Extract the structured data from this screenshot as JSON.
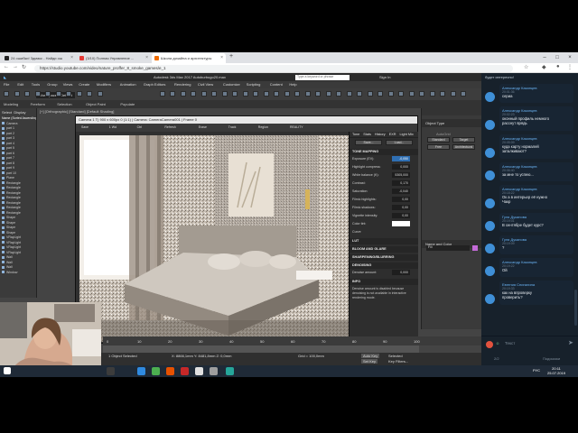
{
  "browser": {
    "tabs": [
      {
        "label": "24 ошибки! 3дмакс - Найди ош"
      },
      {
        "label": "(3/10) Полная Управление ..."
      },
      {
        "label": "Школа дизайна и архитектуры"
      }
    ],
    "url": "https://studio.youtube.com/video/nature_proffer_8_smoke_games/e_1"
  },
  "max": {
    "title": "Autodesk 3ds Max 2017   Autoburbugo20.max",
    "search_placeholder": "Type a keyword or phrase",
    "sign_in": "Sign In",
    "menus": [
      "File",
      "Edit",
      "Tools",
      "Group",
      "Views",
      "Create",
      "Modifiers",
      "Animation",
      "Graph Editors",
      "Rendering",
      "Civil View",
      "Customize",
      "Scripting",
      "Content",
      "Help"
    ],
    "workspace": "Workspaces: Default",
    "ribbon_tabs": [
      "Modeling",
      "Freeform",
      "Selection",
      "Object Paint",
      "Populate"
    ],
    "scene_header": [
      "Select",
      "Display"
    ],
    "scene_col": "Name (Sorted Ascending)",
    "scene_rows": [
      "Camera",
      "part 1",
      "part 2",
      "part 3",
      "part 4",
      "part 5",
      "part 6",
      "part 7",
      "part 8",
      "part 9",
      "part 10",
      "Plane",
      "Rectangle",
      "Rectangle",
      "Rectangle",
      "Rectangle",
      "Rectangle",
      "Rectangle",
      "Rectangle",
      "Shape",
      "Shape",
      "Shape",
      "Shape",
      "VRayLight",
      "VRayLight",
      "VRayLight",
      "VRayLight",
      "Wall",
      "Wall",
      "Wall",
      "Window"
    ],
    "viewport_label": "[+] [Orthographic] [Standard] [Default Shading]",
    "render_window": {
      "title": "Camera 1 T) 900 x 600px 0 (1:1) | Camera: CameraCamera001 | Frame 0",
      "toolbar": [
        "Save",
        "1 Wd",
        "Ctrl",
        "Refresh",
        "Erase",
        "Track",
        "Region",
        "REALITY"
      ],
      "tabs": [
        "Tone",
        "Stats",
        "History",
        "EXR",
        "Light Mix"
      ],
      "buttons": [
        "Save...",
        "Load..."
      ],
      "sections": [
        "TONE MAPPING",
        "LUT",
        "BLOOM AND GLARE",
        "SHARPENING/BLURRING",
        "DENOISING",
        "INFO"
      ],
      "params": [
        {
          "label": "Exposure (EV):",
          "value": "-0,050",
          "hl": true
        },
        {
          "label": "Highlight compress:",
          "value": "0,000"
        },
        {
          "label": "White balance (K):",
          "value": "5305,000"
        },
        {
          "label": "Contrast:",
          "value": "0,170"
        },
        {
          "label": "Saturation:",
          "value": "-0,040"
        },
        {
          "label": "Filmic highlights:",
          "value": "0,00"
        },
        {
          "label": "Filmic shadows:",
          "value": "0,00"
        },
        {
          "label": "Vignette intensity:",
          "value": "0,00"
        },
        {
          "label": "Color tint:",
          "value": ""
        },
        {
          "label": "Curve",
          "value": ""
        }
      ],
      "denoise_label": "Denoise amount:",
      "denoise_value": "0,000",
      "info_text": "Denoise amount is disabled because denoising is not available in interactive rendering mode."
    },
    "command_panel": {
      "section": "Object Type",
      "autogrid": "AutoGrid",
      "types": [
        "Standard",
        "Target",
        "Free",
        "Architectural"
      ],
      "name_section": "Name and Color",
      "name_value": "Fill"
    },
    "timeline": [
      "0",
      "10",
      "20",
      "30",
      "40",
      "50",
      "60",
      "70",
      "80",
      "90",
      "100"
    ],
    "status": {
      "selection": "1 Object Selected",
      "coords": "X: 8866,1mm   Y: 8481,8mm   Z: 0,0mm",
      "grid": "Grid = 100,0mm",
      "autokey": "Auto Key",
      "selected": "Selected",
      "setkey": "Set Key",
      "keyfilters": "Key Filters..."
    }
  },
  "chat": {
    "header_text": "будет интересно!",
    "messages": [
      {
        "from": "Александр Казанцев",
        "time": "20:01:36",
        "text": "сериа"
      },
      {
        "from": "Александр Казанцев",
        "time": "20:02:23",
        "text": "оконный профиль немного",
        "text2": "расснут врядь"
      },
      {
        "from": "Александр Казанцев",
        "time": "20:05:09",
        "text": "куда карту нормалей",
        "text2": "заталкивают?"
      },
      {
        "from": "Александр Казанцев",
        "time": "20:06:40",
        "text": "за мне то успею..."
      },
      {
        "from": "Александр Казанцев",
        "time": "20:18:22",
        "text": "Ок а в интерьер её нужно",
        "text2": "Чакр"
      },
      {
        "from": "Гуля Дуканова",
        "time": "20:19:01",
        "text": "В сентябре будет курс?"
      },
      {
        "from": "Гуля Дуканова",
        "time": "20:19:09",
        "text": "?"
      },
      {
        "from": "Александр Казанцев",
        "time": "20:19:22",
        "text": "Ой"
      },
      {
        "from": "Евгения Снигалина",
        "time": "20:19:33",
        "text": "как на впроверку",
        "text2": "проверить?"
      }
    ],
    "input_placeholder": "Текст",
    "footer_count": "2/2",
    "footer_right": "Подсказки"
  },
  "taskbar": {
    "lang": "РУС",
    "time": "20:11",
    "date": "25.07.2019"
  }
}
